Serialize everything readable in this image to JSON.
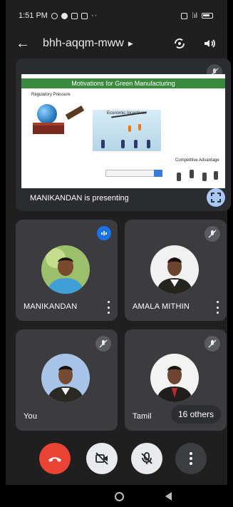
{
  "status_bar": {
    "time": "1:51 PM",
    "extra": "··",
    "signal": "⁞ıl"
  },
  "header": {
    "meeting_code": "bhh-aqqm-mww"
  },
  "presentation": {
    "slide_title": "Motivations for Green Manufacturing",
    "slide_labels": [
      "Regulatory Pressure",
      "Economic Incentives",
      "Competitive Advantage"
    ],
    "presenting_label": "MANIKANDAN is presenting"
  },
  "participants": [
    {
      "name": "MANIKANDAN",
      "muted": false,
      "menu": true
    },
    {
      "name": "AMALA MITHIN",
      "muted": true,
      "menu": true
    },
    {
      "name": "You",
      "muted": true,
      "menu": false
    },
    {
      "name": "Tamil",
      "muted": true,
      "menu": false
    }
  ],
  "others_chip": "16 others",
  "colors": {
    "end_call": "#ea4335",
    "fullscreen": "#a8c7fa",
    "speaking": "#1a73e8",
    "tile_bg": "#3c3c40"
  }
}
